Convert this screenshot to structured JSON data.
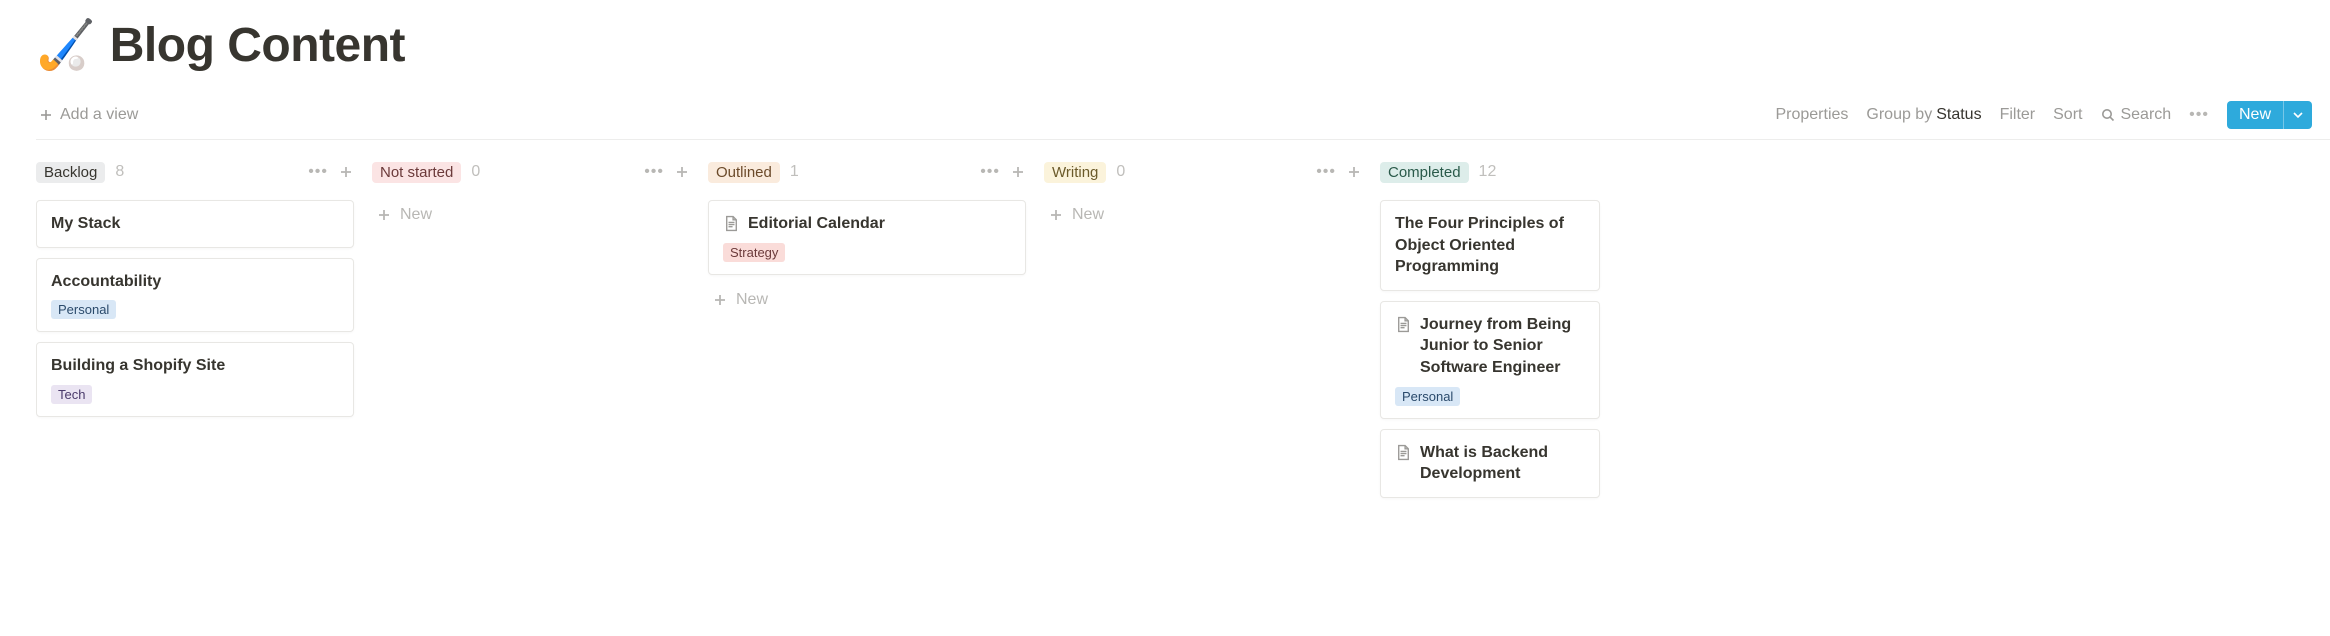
{
  "header": {
    "emoji": "🏑",
    "title": "Blog Content",
    "add_view_label": "Add a view"
  },
  "toolbar": {
    "properties": "Properties",
    "group_by_prefix": "Group by ",
    "group_by_value": "Status",
    "filter": "Filter",
    "sort": "Sort",
    "search": "Search",
    "new_label": "New"
  },
  "new_label": "New",
  "status_colors": {
    "Backlog": {
      "bg": "#ebeced",
      "fg": "#37352f"
    },
    "Not started": {
      "bg": "#fbe4e4",
      "fg": "#6b3a3a"
    },
    "Outlined": {
      "bg": "#faebdd",
      "fg": "#6b4a2a"
    },
    "Writing": {
      "bg": "#fbf3db",
      "fg": "#6b5a2a"
    },
    "Completed": {
      "bg": "#ddedea",
      "fg": "#2a5a4a"
    }
  },
  "tag_colors": {
    "Personal": {
      "bg": "#d8e7f6",
      "fg": "#2a4a6b"
    },
    "Tech": {
      "bg": "#eae4f2",
      "fg": "#4a3a6b"
    },
    "Strategy": {
      "bg": "#fadcd9",
      "fg": "#6b3a3a"
    }
  },
  "columns": [
    {
      "status": "Backlog",
      "count": 8,
      "show_actions": true,
      "show_new_btn": false,
      "cards": [
        {
          "title": "My Stack",
          "tags": [],
          "icon": false
        },
        {
          "title": "Accountability",
          "tags": [
            "Personal"
          ],
          "icon": false
        },
        {
          "title": "Building a Shopify Site",
          "tags": [
            "Tech"
          ],
          "icon": false
        }
      ]
    },
    {
      "status": "Not started",
      "count": 0,
      "show_actions": true,
      "show_new_btn": true,
      "cards": []
    },
    {
      "status": "Outlined",
      "count": 1,
      "show_actions": true,
      "show_new_btn": true,
      "cards": [
        {
          "title": "Editorial Calendar",
          "tags": [
            "Strategy"
          ],
          "icon": true
        }
      ]
    },
    {
      "status": "Writing",
      "count": 0,
      "show_actions": true,
      "show_new_btn": true,
      "cards": []
    },
    {
      "status": "Completed",
      "count": 12,
      "show_actions": false,
      "show_new_btn": false,
      "cards": [
        {
          "title": "The Four Principles of Object Oriented Programming",
          "tags": [],
          "icon": false
        },
        {
          "title": "Journey from Being Junior to Senior Software Engineer",
          "tags": [
            "Personal"
          ],
          "icon": true
        },
        {
          "title": "What is Backend Development",
          "tags": [],
          "icon": true
        }
      ]
    }
  ]
}
